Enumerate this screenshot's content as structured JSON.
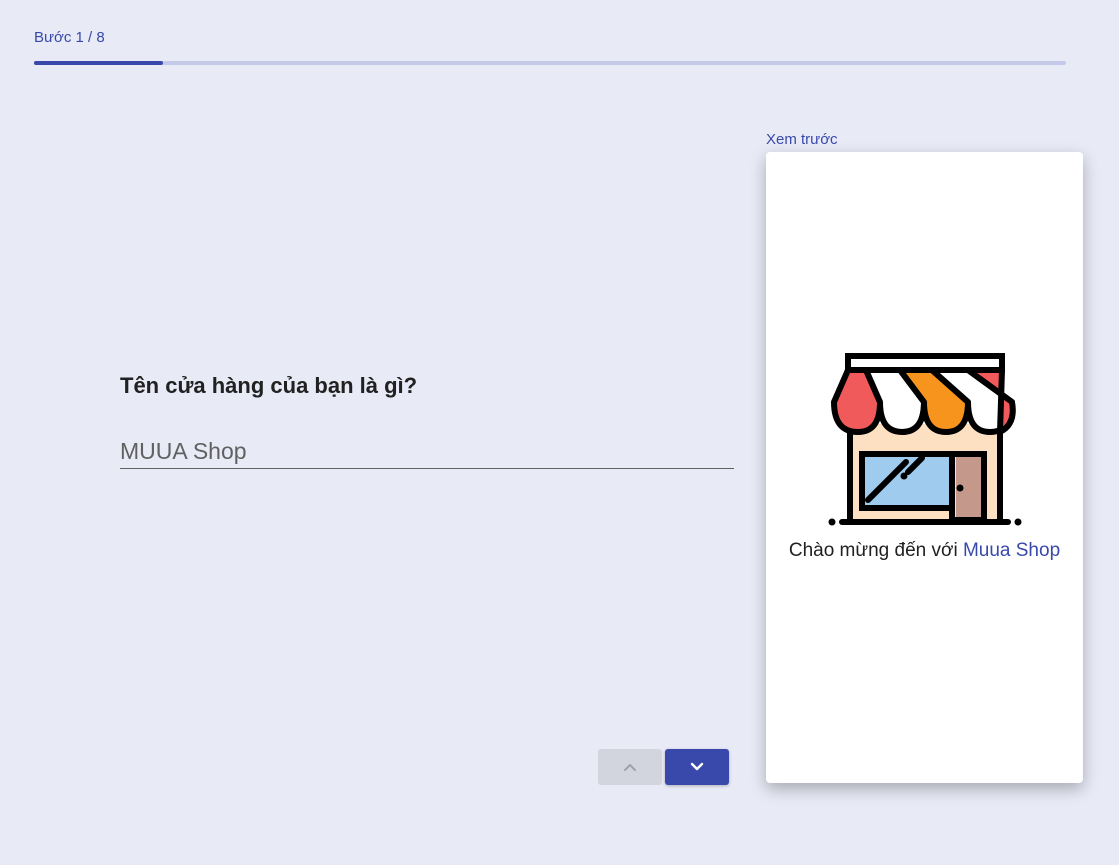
{
  "progress": {
    "step_label": "Bước 1 / 8",
    "current": 1,
    "total": 8
  },
  "form": {
    "question": "Tên cửa hàng của bạn là gì?",
    "shop_name_value": "MUUA Shop"
  },
  "navigation": {
    "prev_icon": "chevron-up-icon",
    "next_icon": "chevron-down-icon"
  },
  "preview": {
    "label": "Xem trước",
    "welcome_prefix": "Chào mừng đến với",
    "shop_name": "Muua Shop",
    "image_icon": "storefront-icon"
  },
  "colors": {
    "background": "#e8eaf6",
    "accent": "#3949ab",
    "progress_track": "#c5cae9",
    "disabled_button": "#d3d5de"
  }
}
